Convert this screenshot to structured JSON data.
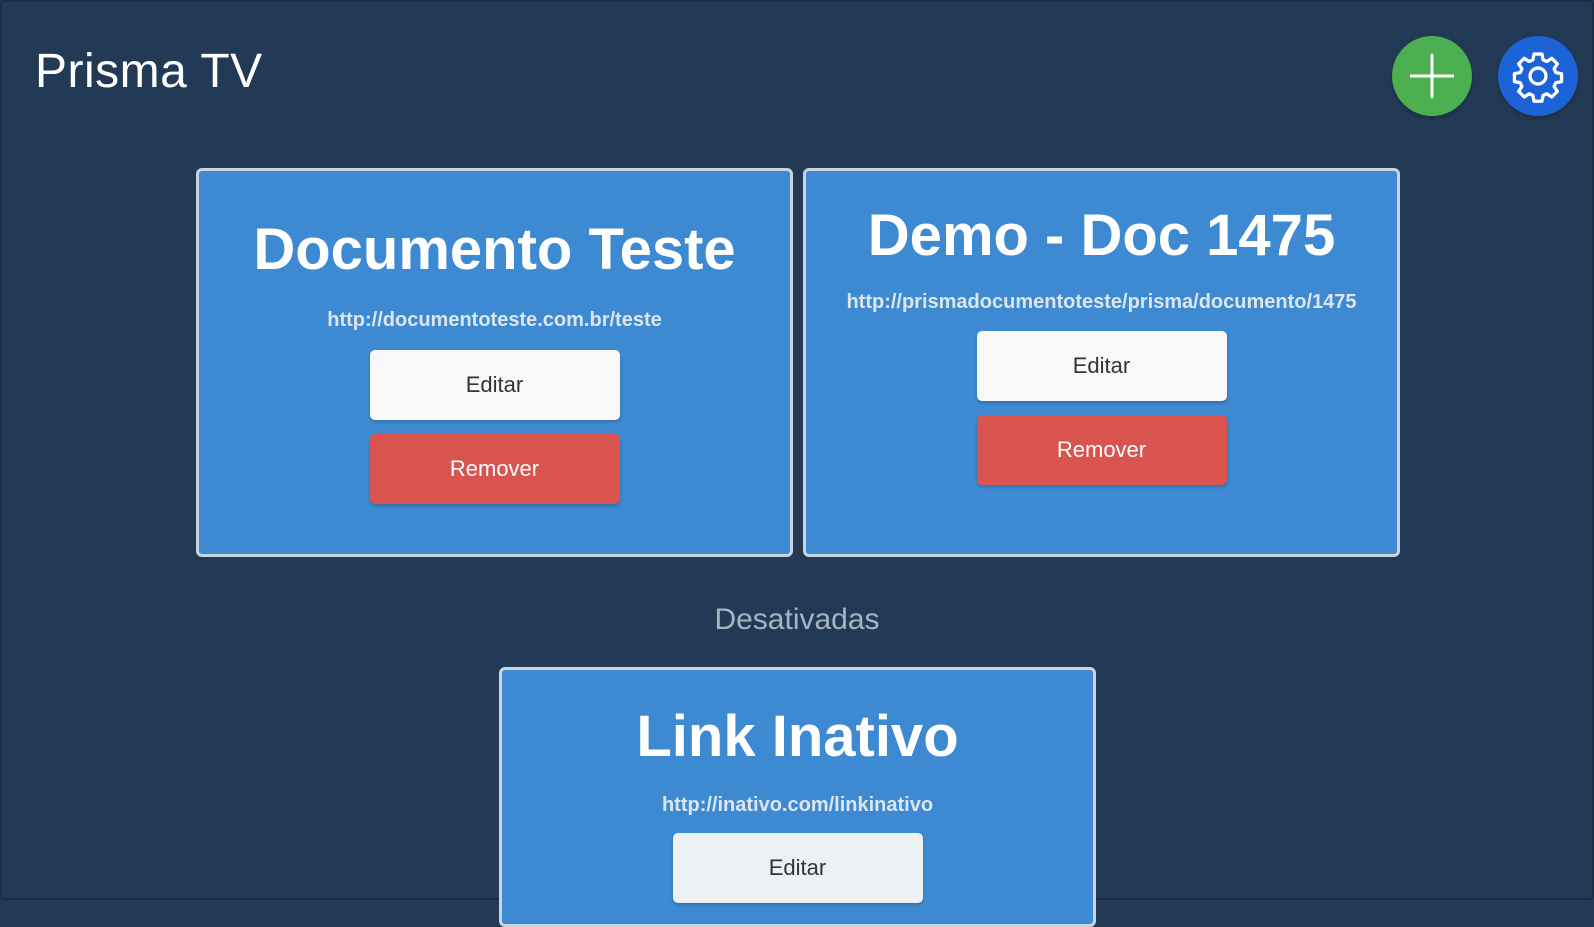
{
  "app": {
    "title": "Prisma TV"
  },
  "header": {
    "add_icon": "plus-icon",
    "settings_icon": "gear-icon",
    "add_color": "#4caf50",
    "settings_color": "#1d63d8"
  },
  "active_cards": [
    {
      "title": "Documento Teste",
      "url": "http://documentoteste.com.br/teste",
      "edit_label": "Editar",
      "remove_label": "Remover"
    },
    {
      "title": "Demo - Doc 1475",
      "url": "http://prismadocumentoteste/prisma/documento/1475",
      "edit_label": "Editar",
      "remove_label": "Remover"
    }
  ],
  "inactive_section": {
    "label": "Desativadas",
    "cards": [
      {
        "title": "Link Inativo",
        "url": "http://inativo.com/linkinativo",
        "edit_label": "Editar"
      }
    ]
  },
  "colors": {
    "background": "#233a56",
    "card": "#3d8ad2",
    "remove_button": "#d9534f",
    "edit_button": "#f8f8f8"
  }
}
